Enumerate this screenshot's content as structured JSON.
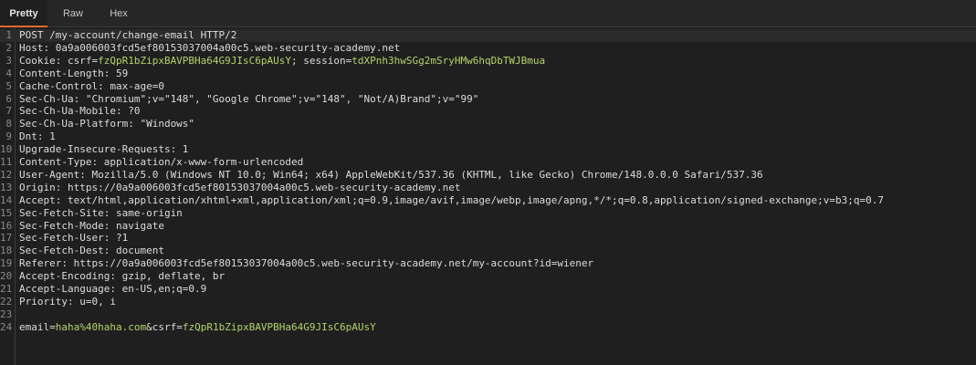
{
  "tabs": [
    {
      "label": "Pretty",
      "active": true
    },
    {
      "label": "Raw",
      "active": false
    },
    {
      "label": "Hex",
      "active": false
    }
  ],
  "colors": {
    "background": "#1f1f1f",
    "text": "#dcdcdc",
    "line_number": "#8a8a8a",
    "highlight": "#b5d36b",
    "active_tab_underline": "#e06a2c"
  },
  "lines": [
    {
      "n": "1",
      "text": "POST /my-account/change-email HTTP/2"
    },
    {
      "n": "2",
      "text": "Host: 0a9a006003fcd5ef80153037004a00c5.web-security-academy.net"
    },
    {
      "n": "3",
      "text": "Cookie: csrf=fzQpR1bZipxBAVPBHa64G9JIsC6pAUsY; session=tdXPnh3hwSGg2mSryHMw6hqDbTWJBmua"
    },
    {
      "n": "4",
      "text": "Content-Length: 59"
    },
    {
      "n": "5",
      "text": "Cache-Control: max-age=0"
    },
    {
      "n": "6",
      "text": "Sec-Ch-Ua: \"Chromium\";v=\"148\", \"Google Chrome\";v=\"148\", \"Not/A)Brand\";v=\"99\""
    },
    {
      "n": "7",
      "text": "Sec-Ch-Ua-Mobile: ?0"
    },
    {
      "n": "8",
      "text": "Sec-Ch-Ua-Platform: \"Windows\""
    },
    {
      "n": "9",
      "text": "Dnt: 1"
    },
    {
      "n": "10",
      "text": "Upgrade-Insecure-Requests: 1"
    },
    {
      "n": "11",
      "text": "Content-Type: application/x-www-form-urlencoded"
    },
    {
      "n": "12",
      "text": "User-Agent: Mozilla/5.0 (Windows NT 10.0; Win64; x64) AppleWebKit/537.36 (KHTML, like Gecko) Chrome/148.0.0.0 Safari/537.36"
    },
    {
      "n": "13",
      "text": "Origin: https://0a9a006003fcd5ef80153037004a00c5.web-security-academy.net"
    },
    {
      "n": "14",
      "text": "Accept: text/html,application/xhtml+xml,application/xml;q=0.9,image/avif,image/webp,image/apng,*/*;q=0.8,application/signed-exchange;v=b3;q=0.7"
    },
    {
      "n": "15",
      "text": "Sec-Fetch-Site: same-origin"
    },
    {
      "n": "16",
      "text": "Sec-Fetch-Mode: navigate"
    },
    {
      "n": "17",
      "text": "Sec-Fetch-User: ?1"
    },
    {
      "n": "18",
      "text": "Sec-Fetch-Dest: document"
    },
    {
      "n": "19",
      "text": "Referer: https://0a9a006003fcd5ef80153037004a00c5.web-security-academy.net/my-account?id=wiener"
    },
    {
      "n": "20",
      "text": "Accept-Encoding: gzip, deflate, br"
    },
    {
      "n": "21",
      "text": "Accept-Language: en-US,en;q=0.9"
    },
    {
      "n": "22",
      "text": "Priority: u=0, i"
    },
    {
      "n": "23",
      "text": ""
    },
    {
      "n": "24",
      "text": "email=haha%40haha.com&csrf=fzQpR1bZipxBAVPBHa64G9JIsC6pAUsY"
    }
  ],
  "highlights": {
    "cookie_csrf_value": "fzQpR1bZipxBAVPBHa64G9JIsC6pAUsY",
    "cookie_session_value": "tdXPnh3hwSGg2mSryHMw6hqDbTWJBmua",
    "body_email_value": "haha%40haha.com",
    "body_csrf_value": "fzQpR1bZipxBAVPBHa64G9JIsC6pAUsY"
  }
}
